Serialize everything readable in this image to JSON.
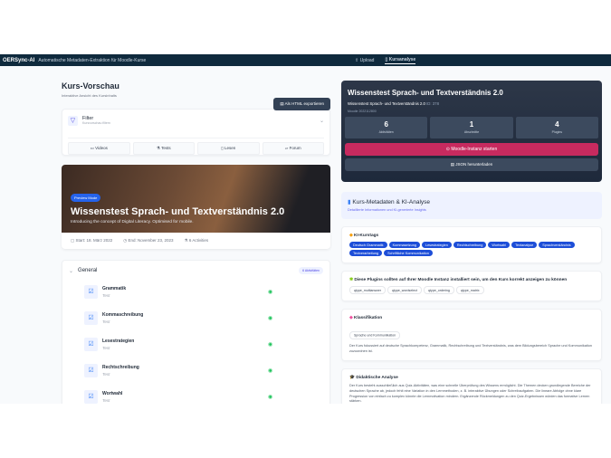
{
  "header": {
    "brand": "OERSync-AI",
    "subtitle": "Automatische Metadaten-Extraktion für Moodle-Kurse",
    "nav": [
      {
        "label": "Upload",
        "icon": "upload-icon"
      },
      {
        "label": "Kursanalyse",
        "icon": "book-icon",
        "active": true
      }
    ]
  },
  "left": {
    "title": "Kurs-Vorschau",
    "subtitle": "Interaktive Ansicht des Kursinhalts",
    "export_label": "Als HTML exportieren",
    "filter": {
      "title": "Filter",
      "subtitle": "Kursvorschau filtern",
      "buttons": [
        "Videos",
        "Tests",
        "Lesen",
        "Forum"
      ]
    },
    "hero": {
      "badge": "Preview Mode",
      "title": "Wissenstest Sprach- und Textverständnis 2.0",
      "description": "Introducing the concept of Digital Literacy. Optimised for mobile.",
      "start": "Start: 18. März 2022",
      "end": "End: November 23, 2023",
      "activities": "6 Activities"
    },
    "section": {
      "title": "General",
      "badge": "6 Aktivitäten",
      "items": [
        {
          "name": "Grammatik",
          "type": "Test"
        },
        {
          "name": "Kommaschreibung",
          "type": "Test"
        },
        {
          "name": "Lesestrategien",
          "type": "Test"
        },
        {
          "name": "Rechtschreibung",
          "type": "Test"
        },
        {
          "name": "Wortwahl",
          "type": "Test"
        }
      ]
    }
  },
  "right": {
    "course": {
      "title": "Wissenstest Sprach- und Textverständnis 2.0",
      "shortname": "Wissenstest Sprach- und Textverständnis 2.0",
      "id": "ID: 378",
      "version": "Moodle 2022112800",
      "stats": [
        {
          "value": "6",
          "label": "Aktivitäten"
        },
        {
          "value": "1",
          "label": "Abschnitte"
        },
        {
          "value": "4",
          "label": "Plugins"
        }
      ],
      "start_label": "Moodle-Instanz starten",
      "download_label": "JSON herunterladen"
    },
    "meta": {
      "title": "Kurs-Metadaten & KI-Analyse",
      "subtitle": "Detaillierte Informationen und KI-generierte Insights"
    },
    "tags": {
      "title": "KI-Kurstags",
      "items": [
        "Deutsch Grammatik",
        "Kommasetzung",
        "Lesestrategien",
        "Rechtschreibung",
        "Wortwahl",
        "Textanalyse",
        "Sprachverständnis",
        "Textverarbeitung",
        "Schriftliche Kommunikation"
      ]
    },
    "plugins": {
      "title": "Diese Plugins sollten auf Ihrer Moodle Instanz installiert sein, um den Kurs korrekt anzeigen zu können",
      "items": [
        "qtype_multianswer",
        "qtype_wordselect",
        "qtype_ordering",
        "qtype_matrix"
      ]
    },
    "classification": {
      "title": "Klassifikation",
      "tag": "Sprache und Kommunikation",
      "text": "Der Kurs fokussiert auf deutsche Sprachkompetenz, Grammatik, Rechtschreibung und Textverständnis, was dem Bildungsbereich Sprache und Kommunikation zuzuordnen ist."
    },
    "didactic": {
      "title": "Didaktische Analyse",
      "text": "Der Kurs besteht ausschließlich aus Quiz-Aktivitäten, was eine schnelle Überprüfung des Wissens ermöglicht. Die Themen decken grundlegende Bereiche der deutschen Sprache ab, jedoch fehlt eine Variation in den Lernmethoden, z. B. interaktive Übungen oder Schreibaufgaben. Die lineare Abfolge ohne klare Progression von einfach zu komplex könnte die Lernmotivation mindern. Ergänzende Rückmeldungen zu den Quiz-Ergebnissen würden das formative Lernen stärken."
    }
  }
}
